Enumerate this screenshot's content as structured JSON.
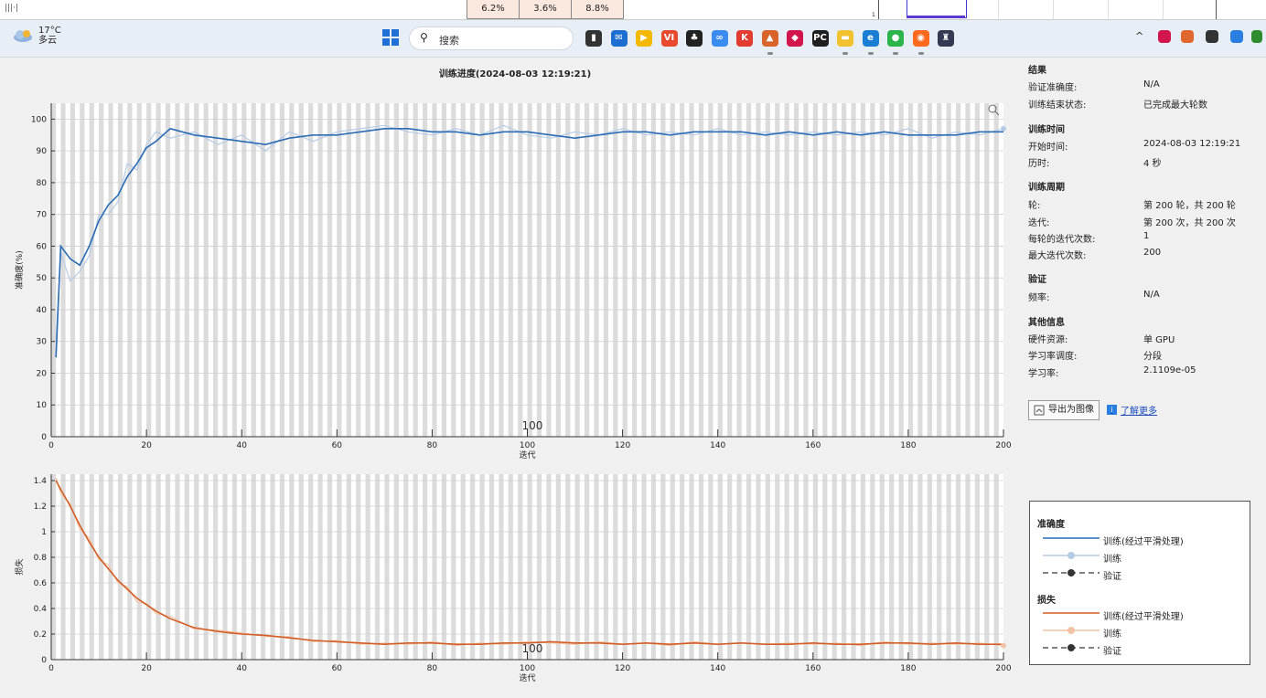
{
  "top_strip": {
    "cells": [
      "6.2%",
      "3.6%",
      "8.8%"
    ],
    "mini_plot_label": "1"
  },
  "taskbar": {
    "weather_temp": "17°C",
    "weather_desc": "多云",
    "search_placeholder": "搜索",
    "icons": [
      {
        "name": "file-explorer-dark-icon",
        "color": "#333333",
        "glyph": "▮"
      },
      {
        "name": "mail-icon",
        "color": "#1c6fd0",
        "glyph": "✉"
      },
      {
        "name": "media-player-icon",
        "color": "#f5b800",
        "glyph": "▶"
      },
      {
        "name": "vi-app-icon",
        "color": "#e84a2e",
        "glyph": "VI"
      },
      {
        "name": "qq-penguin-icon",
        "color": "#222222",
        "glyph": "♣"
      },
      {
        "name": "baidu-netdisk-icon",
        "color": "#3b8cf0",
        "glyph": "∞"
      },
      {
        "name": "k-app-icon",
        "color": "#e23b2f",
        "glyph": "K"
      },
      {
        "name": "matlab-icon",
        "color": "#d8642b",
        "glyph": "▲"
      },
      {
        "name": "red-note-icon",
        "color": "#d2154d",
        "glyph": "◆"
      },
      {
        "name": "pycharm-icon",
        "color": "#1f1f1f",
        "glyph": "PC"
      },
      {
        "name": "folder-icon",
        "color": "#f2c12e",
        "glyph": "▬"
      },
      {
        "name": "edge-browser-icon",
        "color": "#1a7fd4",
        "glyph": "e"
      },
      {
        "name": "wechat-icon",
        "color": "#2bb44a",
        "glyph": "●"
      },
      {
        "name": "firefox-icon",
        "color": "#ff6a1f",
        "glyph": "◉"
      },
      {
        "name": "cat-app-icon",
        "color": "#333a52",
        "glyph": "♜"
      }
    ],
    "tray": [
      "^"
    ]
  },
  "training": {
    "title": "训练进度(2024-08-03 12:19:21)",
    "accuracy_ylabel": "准确度(%)",
    "loss_ylabel": "损失",
    "xlabel": "迭代",
    "epoch_marker": "100"
  },
  "info": {
    "results_header": "结果",
    "val_acc_label": "验证准确度:",
    "val_acc_value": "N/A",
    "status_label": "训练结束状态:",
    "status_value": "已完成最大轮数",
    "time_header": "训练时间",
    "start_label": "开始时间:",
    "start_value": "2024-08-03 12:19:21",
    "elapsed_label": "历时:",
    "elapsed_value": "4 秒",
    "cycle_header": "训练周期",
    "epoch_label": "轮:",
    "epoch_value": "第 200 轮，共 200 轮",
    "iter_label": "迭代:",
    "iter_value": "第 200 次，共 200 次",
    "iter_per_epoch_label": "每轮的迭代次数:",
    "iter_per_epoch_value": "1",
    "max_iter_label": "最大迭代次数:",
    "max_iter_value": "200",
    "validation_header": "验证",
    "freq_label": "频率:",
    "freq_value": "N/A",
    "other_header": "其他信息",
    "hw_label": "硬件资源:",
    "hw_value": "单 GPU",
    "lr_sched_label": "学习率调度:",
    "lr_sched_value": "分段",
    "lr_label": "学习率:",
    "lr_value": "2.1109e-05",
    "export_button": "导出为图像",
    "learn_more": "了解更多"
  },
  "legend": {
    "acc_header": "准确度",
    "acc_smooth": "训练(经过平滑处理)",
    "acc_train": "训练",
    "acc_val": "验证",
    "loss_header": "损失",
    "loss_smooth": "训练(经过平滑处理)",
    "loss_train": "训练",
    "loss_val": "验证"
  },
  "colors": {
    "acc_smooth": "#2b6cb5",
    "acc_raw": "#b6cce6",
    "loss_smooth": "#d35d24",
    "loss_raw": "#f2c3a6"
  },
  "chart_data": [
    {
      "type": "line",
      "title": "训练进度(2024-08-03 12:19:21)",
      "xlabel": "迭代",
      "ylabel": "准确度(%)",
      "xlim": [
        0,
        200
      ],
      "ylim": [
        0,
        105
      ],
      "xticks": [
        0,
        20,
        40,
        60,
        80,
        100,
        120,
        140,
        160,
        180,
        200
      ],
      "yticks": [
        0,
        10,
        20,
        30,
        40,
        50,
        60,
        70,
        80,
        90,
        100
      ],
      "x": [
        1,
        2,
        4,
        6,
        8,
        10,
        12,
        14,
        16,
        18,
        20,
        22,
        25,
        30,
        35,
        40,
        45,
        50,
        55,
        60,
        65,
        70,
        75,
        80,
        85,
        90,
        95,
        100,
        105,
        110,
        115,
        120,
        125,
        130,
        135,
        140,
        145,
        150,
        155,
        160,
        165,
        170,
        175,
        180,
        185,
        190,
        195,
        200
      ],
      "series": [
        {
          "name": "训练(经过平滑处理)",
          "values": [
            25,
            60,
            56,
            54,
            60,
            68,
            73,
            76,
            82,
            86,
            91,
            93,
            97,
            95,
            94,
            93,
            92,
            94,
            95,
            95,
            96,
            97,
            97,
            96,
            96,
            95,
            96,
            96,
            95,
            94,
            95,
            96,
            96,
            95,
            96,
            96,
            96,
            95,
            96,
            95,
            96,
            95,
            96,
            95,
            95,
            95,
            96,
            96
          ]
        },
        {
          "name": "训练",
          "values": [
            30,
            58,
            49,
            52,
            57,
            70,
            70,
            74,
            86,
            84,
            92,
            96,
            94,
            96,
            92,
            95,
            90,
            96,
            93,
            96,
            97,
            98,
            96,
            95,
            97,
            95,
            98,
            95,
            94,
            96,
            95,
            97,
            95,
            96,
            95,
            97,
            95,
            96,
            95,
            96,
            95,
            96,
            95,
            97,
            94,
            96,
            95,
            97
          ]
        }
      ]
    },
    {
      "type": "line",
      "xlabel": "迭代",
      "ylabel": "损失",
      "xlim": [
        0,
        200
      ],
      "ylim": [
        0,
        1.45
      ],
      "xticks": [
        0,
        20,
        40,
        60,
        80,
        100,
        120,
        140,
        160,
        180,
        200
      ],
      "yticks": [
        0,
        0.2,
        0.4,
        0.6,
        0.8,
        1,
        1.2,
        1.4
      ],
      "x": [
        1,
        2,
        4,
        6,
        8,
        10,
        12,
        14,
        16,
        18,
        20,
        22,
        25,
        30,
        35,
        40,
        45,
        50,
        55,
        60,
        65,
        70,
        75,
        80,
        85,
        90,
        95,
        100,
        105,
        110,
        115,
        120,
        125,
        130,
        135,
        140,
        145,
        150,
        155,
        160,
        165,
        170,
        175,
        180,
        185,
        190,
        195,
        200
      ],
      "series": [
        {
          "name": "训练(经过平滑处理)",
          "values": [
            1.4,
            1.33,
            1.2,
            1.05,
            0.92,
            0.8,
            0.71,
            0.62,
            0.55,
            0.48,
            0.43,
            0.38,
            0.32,
            0.25,
            0.22,
            0.2,
            0.19,
            0.17,
            0.15,
            0.14,
            0.13,
            0.12,
            0.13,
            0.13,
            0.12,
            0.12,
            0.13,
            0.13,
            0.14,
            0.13,
            0.13,
            0.12,
            0.13,
            0.12,
            0.13,
            0.12,
            0.13,
            0.12,
            0.12,
            0.13,
            0.12,
            0.12,
            0.13,
            0.13,
            0.12,
            0.13,
            0.12,
            0.12
          ]
        },
        {
          "name": "训练",
          "values": [
            1.42,
            1.3,
            1.22,
            1.02,
            0.95,
            0.78,
            0.74,
            0.6,
            0.57,
            0.45,
            0.44,
            0.36,
            0.34,
            0.24,
            0.23,
            0.21,
            0.18,
            0.18,
            0.14,
            0.15,
            0.12,
            0.13,
            0.12,
            0.14,
            0.11,
            0.13,
            0.12,
            0.14,
            0.13,
            0.12,
            0.14,
            0.12,
            0.13,
            0.11,
            0.14,
            0.12,
            0.13,
            0.12,
            0.13,
            0.12,
            0.13,
            0.11,
            0.14,
            0.12,
            0.13,
            0.12,
            0.13,
            0.11
          ]
        }
      ]
    }
  ]
}
